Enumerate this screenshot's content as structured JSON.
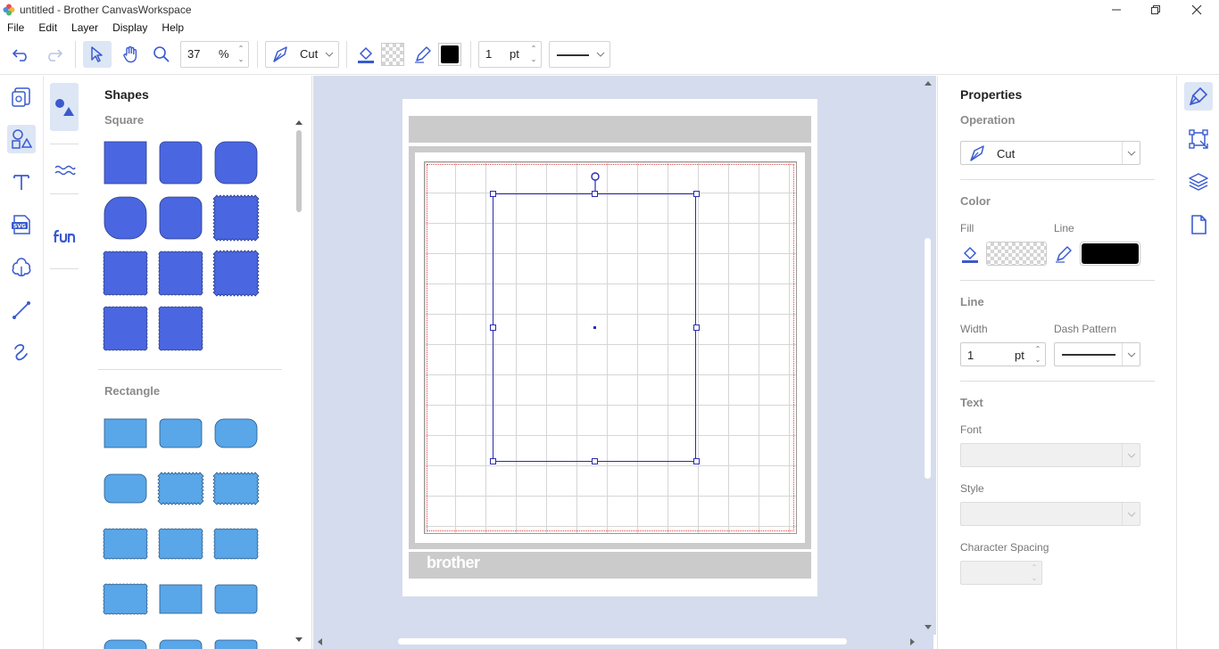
{
  "window": {
    "title": "untitled - Brother CanvasWorkspace"
  },
  "menu": {
    "items": [
      "File",
      "Edit",
      "Layer",
      "Display",
      "Help"
    ]
  },
  "toolbar": {
    "zoom_value": "37",
    "zoom_unit": "%",
    "operation_value": "Cut",
    "line_width_value": "1",
    "line_width_unit": "pt"
  },
  "shapes_panel": {
    "title": "Shapes",
    "sections": [
      {
        "title": "Square",
        "color": "#4a66e0",
        "count": 11
      },
      {
        "title": "Rectangle",
        "color": "#59a6e8",
        "count": 15
      }
    ]
  },
  "canvas": {
    "mat_brand": "brother"
  },
  "properties": {
    "title": "Properties",
    "operation_section": "Operation",
    "operation_value": "Cut",
    "color_section": "Color",
    "fill_label": "Fill",
    "line_label": "Line",
    "line_color": "#000000",
    "line_section": "Line",
    "width_label": "Width",
    "width_value": "1",
    "width_unit": "pt",
    "dash_label": "Dash Pattern",
    "text_section": "Text",
    "font_label": "Font",
    "style_label": "Style",
    "spacing_label": "Character Spacing"
  },
  "colors": {
    "accent": "#3a5ad0",
    "canvas_bg": "#d5dcee",
    "selection": "#2a2ab0"
  }
}
